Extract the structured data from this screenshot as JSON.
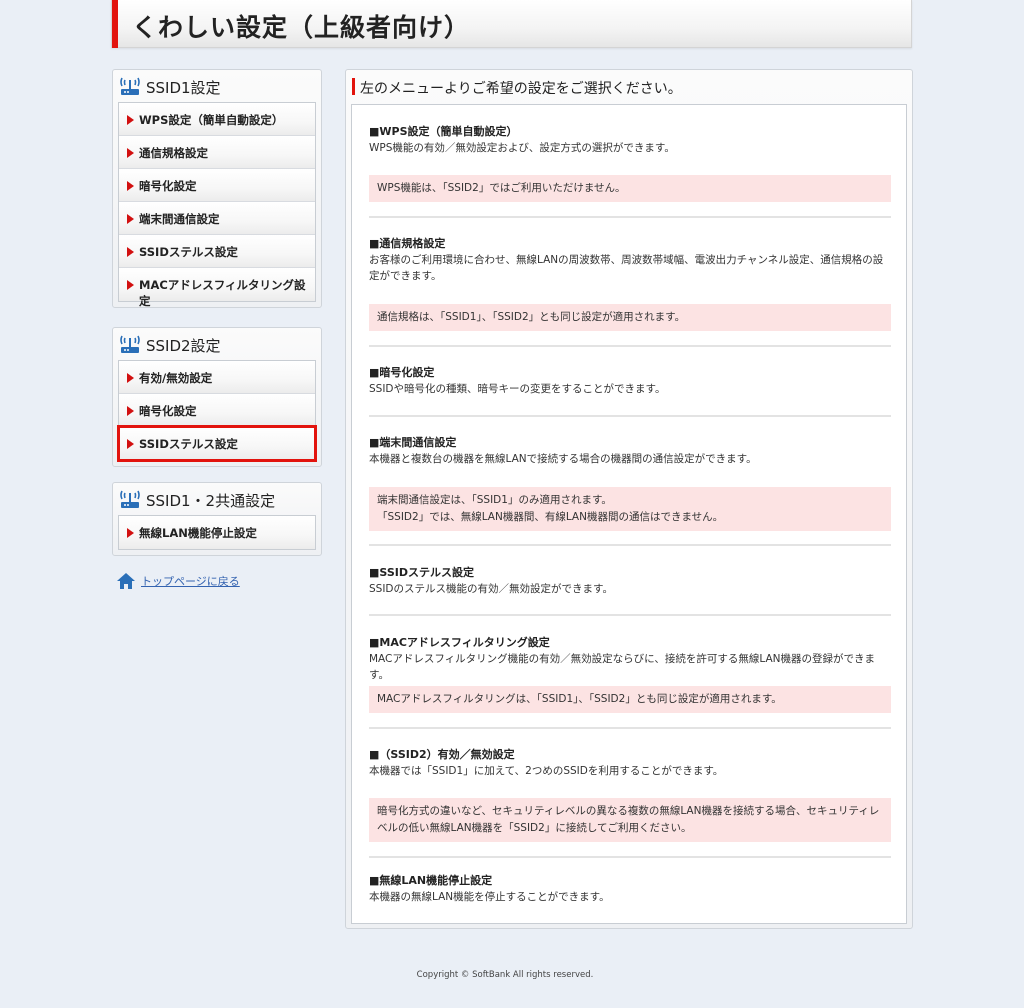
{
  "header": {
    "title": "くわしい設定（上級者向け）"
  },
  "sidebar": {
    "ssid1": {
      "title": "SSID1設定",
      "items": [
        "WPS設定（簡単自動設定）",
        "通信規格設定",
        "暗号化設定",
        "端末間通信設定",
        "SSIDステルス設定",
        "MACアドレスフィルタリング設定"
      ]
    },
    "ssid2": {
      "title": "SSID2設定",
      "items": [
        "有効/無効設定",
        "暗号化設定",
        "SSIDステルス設定"
      ],
      "selected_index": 2
    },
    "common": {
      "title": "SSID1・2共通設定",
      "items": [
        "無線LAN機能停止設定"
      ]
    },
    "back_link": "トップページに戻る"
  },
  "main": {
    "heading": "左のメニューよりご希望の設定をご選択ください。",
    "sections": [
      {
        "title": "■WPS設定（簡単自動設定）",
        "desc": "WPS機能の有効／無効設定および、設定方式の選択ができます。",
        "note": "WPS機能は、「SSID2」ではご利用いただけません。"
      },
      {
        "title": "■通信規格設定",
        "desc": "お客様のご利用環境に合わせ、無線LANの周波数帯、周波数帯域幅、電波出力チャンネル設定、通信規格の設定ができます。",
        "note": "通信規格は、「SSID1」、「SSID2」とも同じ設定が適用されます。"
      },
      {
        "title": "■暗号化設定",
        "desc": "SSIDや暗号化の種類、暗号キーの変更をすることができます。"
      },
      {
        "title": "■端末間通信設定",
        "desc": "本機器と複数台の機器を無線LANで接続する場合の機器間の通信設定ができます。",
        "note": "端末間通信設定は、「SSID1」のみ適用されます。",
        "note2": "「SSID2」では、無線LAN機器間、有線LAN機器間の通信はできません。"
      },
      {
        "title": "■SSIDステルス設定",
        "desc": "SSIDのステルス機能の有効／無効設定ができます。"
      },
      {
        "title": "■MACアドレスフィルタリング設定",
        "desc": "MACアドレスフィルタリング機能の有効／無効設定ならびに、接続を許可する無線LAN機器の登録ができます。",
        "note": "MACアドレスフィルタリングは、「SSID1」、「SSID2」とも同じ設定が適用されます。"
      },
      {
        "title": "■（SSID2）有効／無効設定",
        "desc": "本機器では「SSID1」に加えて、2つめのSSIDを利用することができます。",
        "note": "暗号化方式の違いなど、セキュリティレベルの異なる複数の無線LAN機器を接続する場合、セキュリティレベルの低い無線LAN機器を「SSID2」に接続してご利用ください。"
      },
      {
        "title": "■無線LAN機能停止設定",
        "desc": "本機器の無線LAN機能を停止することができます。"
      }
    ]
  },
  "footer": {
    "copyright": "Copyright © SoftBank All rights reserved."
  },
  "colors": {
    "accent": "#e2130d",
    "note_bg": "#fce3e3",
    "link": "#3463b0",
    "background": "#eaeff6"
  },
  "icons": {
    "menu_header": "wireless-router-icon",
    "menu_item": "red-triangle-icon",
    "back_link": "home-icon"
  }
}
